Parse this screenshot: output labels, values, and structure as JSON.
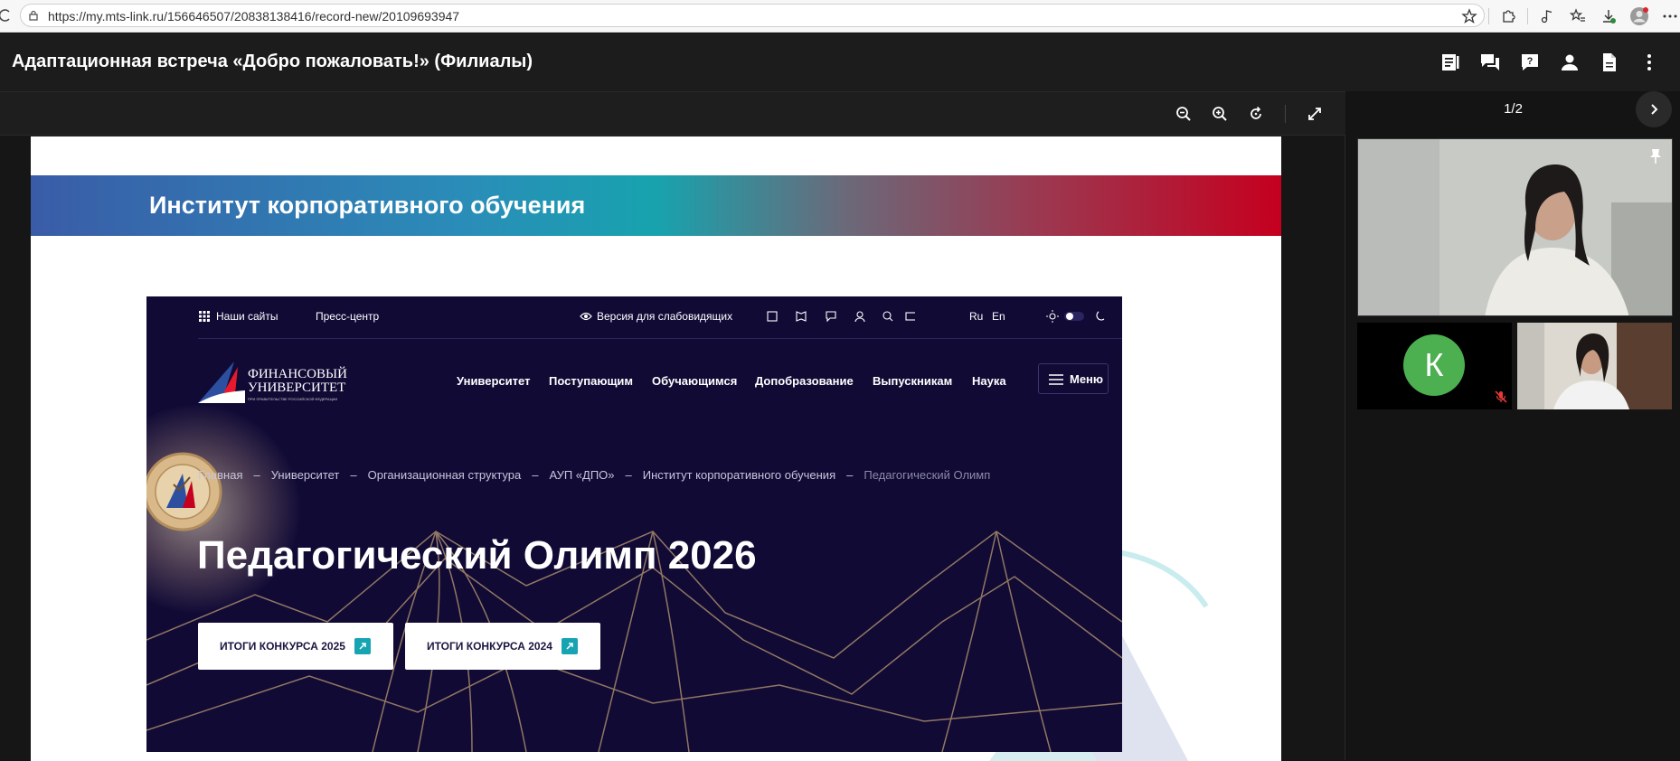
{
  "browser": {
    "url": "https://my.mts-link.ru/156646507/20838138416/record-new/20109693947",
    "icons": [
      "star-icon",
      "extensions-icon",
      "media-icon",
      "favorites-icon",
      "downloads-icon",
      "profile-icon",
      "more-icon"
    ]
  },
  "app": {
    "title": "Адаптационная встреча «Добро пожаловать!» (Филиалы)",
    "header_icons": [
      "notes-icon",
      "chat-icon",
      "question-icon",
      "participants-icon",
      "file-icon",
      "more-vertical-icon"
    ]
  },
  "viewer": {
    "toolbar_icons": [
      "zoom-out-icon",
      "zoom-in-icon",
      "rotate-icon",
      "fullscreen-icon"
    ]
  },
  "slide": {
    "banner_title": "Институт корпоративного обучения",
    "site": {
      "top_left": [
        "Наши сайты",
        "Пресс-центр"
      ],
      "accessibility": "Версия для слабовидящих",
      "languages": [
        "Ru",
        "En"
      ],
      "logo_line1": "ФИНАНСОВЫЙ",
      "logo_line2": "УНИВЕРСИТЕТ",
      "logo_line3": "ПРИ ПРАВИТЕЛЬСТВЕ РОССИЙСКОЙ ФЕДЕРАЦИИ",
      "nav": [
        "Университет",
        "Поступающим",
        "Обучающимся",
        "Допобразование",
        "Выпускникам",
        "Наука"
      ],
      "menu_label": "Меню",
      "breadcrumb": [
        "Главная",
        "Университет",
        "Организационная структура",
        "АУП «ДПО»",
        "Институт корпоративного обучения"
      ],
      "breadcrumb_current": "Педагогический Олимп",
      "hero_title": "Педагогический Олимп 2026",
      "buttons": [
        "ИТОГИ КОНКУРСА 2025",
        "ИТОГИ КОНКУРСА 2024"
      ]
    }
  },
  "side": {
    "page_counter": "1/2",
    "participant_initial": "К"
  },
  "colors": {
    "accent_teal": "#16a4b2",
    "site_bg": "#100a35",
    "avatar_green": "#4caf50",
    "banner_red": "#c5001f"
  }
}
